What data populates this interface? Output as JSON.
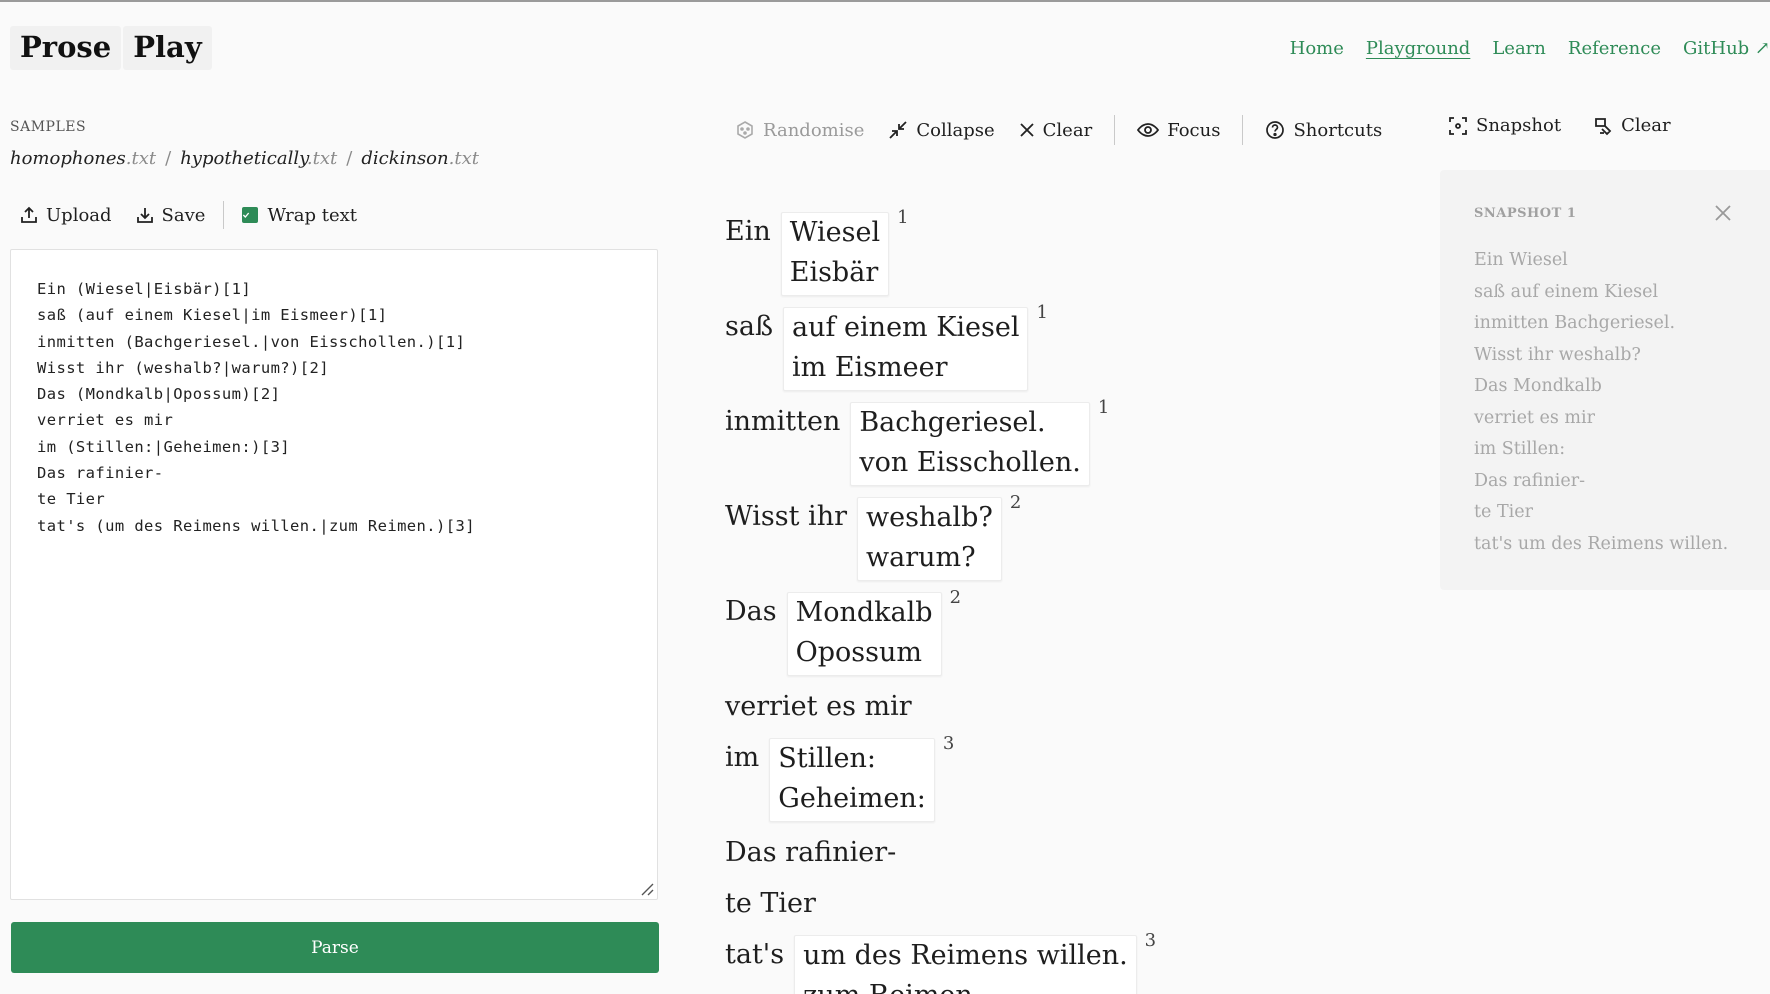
{
  "app": {
    "logo_left": "Prose",
    "logo_right": "Play"
  },
  "nav": {
    "items": [
      "Home",
      "Playground",
      "Learn",
      "Reference",
      "GitHub ↗"
    ],
    "active": "Playground"
  },
  "samples": {
    "label": "SAMPLES",
    "files": [
      {
        "name": "homophones",
        "ext": ".txt"
      },
      {
        "name": "hypothetically",
        "ext": ".txt"
      },
      {
        "name": "dickinson",
        "ext": ".txt"
      }
    ],
    "separator": "/"
  },
  "left_toolbar": {
    "upload": "Upload",
    "save": "Save",
    "wrap_text": "Wrap text",
    "wrap_checked": true
  },
  "editor": {
    "source": "Ein (Wiesel|Eisbär)[1]\nsaß (auf einem Kiesel|im Eismeer)[1]\ninmitten (Bachgeriesel.|von Eisschollen.)[1]\nWisst ihr (weshalb?|warum?)[2]\nDas (Mondkalb|Opossum)[2]\nverriet es mir\nim (Stillen:|Geheimen:)[3]\nDas rafinier-\nte Tier\ntat's (um des Reimens willen.|zum Reimen.)[3]"
  },
  "parse_button": "Parse",
  "mid_toolbar": {
    "randomise": "Randomise",
    "collapse": "Collapse",
    "clear": "Clear",
    "focus": "Focus",
    "shortcuts": "Shortcuts"
  },
  "right_toolbar": {
    "snapshot": "Snapshot",
    "clear": "Clear"
  },
  "poem": [
    {
      "text": "Ein",
      "alts": [
        "Wiesel",
        "Eisbär"
      ],
      "group": "1"
    },
    {
      "text": "saß",
      "alts": [
        "auf einem Kiesel",
        "im Eismeer"
      ],
      "group": "1"
    },
    {
      "text": "inmitten",
      "alts": [
        "Bachgeriesel.",
        "von Eisschollen."
      ],
      "group": "1"
    },
    {
      "text": "Wisst ihr",
      "alts": [
        "weshalb?",
        "warum?"
      ],
      "group": "2"
    },
    {
      "text": "Das",
      "alts": [
        "Mondkalb",
        "Opossum"
      ],
      "group": "2"
    },
    {
      "text": "verriet es mir"
    },
    {
      "text": "im",
      "alts": [
        "Stillen:",
        "Geheimen:"
      ],
      "group": "3"
    },
    {
      "text": "Das rafinier-"
    },
    {
      "text": "te Tier"
    },
    {
      "text": "tat's",
      "alts": [
        "um des Reimens willen.",
        "zum Reimen."
      ],
      "group": "3"
    }
  ],
  "snapshot_panel": {
    "title": "SNAPSHOT 1",
    "lines": [
      "Ein Wiesel",
      "saß auf einem Kiesel",
      "inmitten Bachgeriesel.",
      "Wisst ihr weshalb?",
      "Das Mondkalb",
      "verriet es mir",
      "im Stillen:",
      "Das rafinier-",
      "te Tier",
      "tat's um des Reimens willen."
    ]
  }
}
